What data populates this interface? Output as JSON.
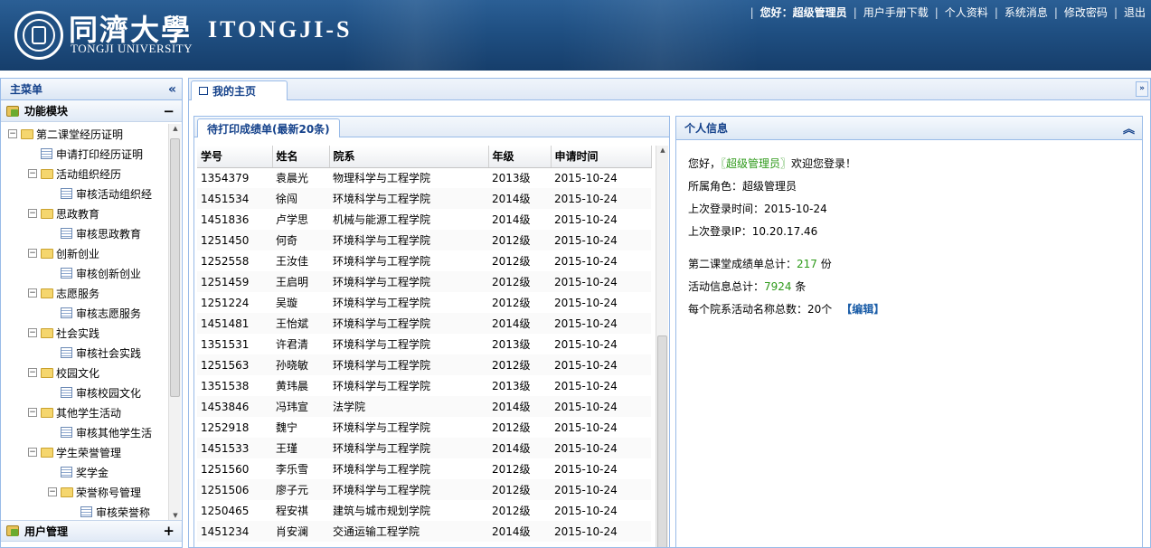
{
  "header": {
    "uni_cn": "同濟大學",
    "uni_en": "TONGJI UNIVERSITY",
    "app_title": "ITONGJI-S",
    "greeting": "您好：超级管理员",
    "links": [
      "用户手册下载",
      "个人资料",
      "系统消息",
      "修改密码",
      "退出"
    ]
  },
  "sidebar": {
    "title": "主菜单",
    "section_title": "功能模块",
    "tree": [
      {
        "label": "第二课堂经历证明",
        "level": 0,
        "type": "folder"
      },
      {
        "label": "申请打印经历证明",
        "level": 1,
        "type": "leaf"
      },
      {
        "label": "活动组织经历",
        "level": 1,
        "type": "folder"
      },
      {
        "label": "审核活动组织经",
        "level": 2,
        "type": "leaf"
      },
      {
        "label": "思政教育",
        "level": 1,
        "type": "folder"
      },
      {
        "label": "审核思政教育",
        "level": 2,
        "type": "leaf"
      },
      {
        "label": "创新创业",
        "level": 1,
        "type": "folder"
      },
      {
        "label": "审核创新创业",
        "level": 2,
        "type": "leaf"
      },
      {
        "label": "志愿服务",
        "level": 1,
        "type": "folder"
      },
      {
        "label": "审核志愿服务",
        "level": 2,
        "type": "leaf"
      },
      {
        "label": "社会实践",
        "level": 1,
        "type": "folder"
      },
      {
        "label": "审核社会实践",
        "level": 2,
        "type": "leaf"
      },
      {
        "label": "校园文化",
        "level": 1,
        "type": "folder"
      },
      {
        "label": "审核校园文化",
        "level": 2,
        "type": "leaf"
      },
      {
        "label": "其他学生活动",
        "level": 1,
        "type": "folder"
      },
      {
        "label": "审核其他学生活",
        "level": 2,
        "type": "leaf"
      },
      {
        "label": "学生荣誉管理",
        "level": 1,
        "type": "folder"
      },
      {
        "label": "奖学金",
        "level": 2,
        "type": "leaf"
      },
      {
        "label": "荣誉称号管理",
        "level": 2,
        "type": "folder"
      },
      {
        "label": "审核荣誉称",
        "level": 3,
        "type": "leaf"
      }
    ],
    "bottom_section": "用户管理"
  },
  "tabs": {
    "home": "我的主页"
  },
  "records": {
    "title": "待打印成绩单(最新20条)",
    "columns": [
      "学号",
      "姓名",
      "院系",
      "年级",
      "申请时间"
    ],
    "rows": [
      [
        "1354379",
        "袁晨光",
        "物理科学与工程学院",
        "2013级",
        "2015-10-24"
      ],
      [
        "1451534",
        "徐闯",
        "环境科学与工程学院",
        "2014级",
        "2015-10-24"
      ],
      [
        "1451836",
        "卢学思",
        "机械与能源工程学院",
        "2014级",
        "2015-10-24"
      ],
      [
        "1251450",
        "何奇",
        "环境科学与工程学院",
        "2012级",
        "2015-10-24"
      ],
      [
        "1252558",
        "王汝佳",
        "环境科学与工程学院",
        "2012级",
        "2015-10-24"
      ],
      [
        "1251459",
        "王启明",
        "环境科学与工程学院",
        "2012级",
        "2015-10-24"
      ],
      [
        "1251224",
        "吴璇",
        "环境科学与工程学院",
        "2012级",
        "2015-10-24"
      ],
      [
        "1451481",
        "王怡斌",
        "环境科学与工程学院",
        "2014级",
        "2015-10-24"
      ],
      [
        "1351531",
        "许君清",
        "环境科学与工程学院",
        "2013级",
        "2015-10-24"
      ],
      [
        "1251563",
        "孙晓敏",
        "环境科学与工程学院",
        "2012级",
        "2015-10-24"
      ],
      [
        "1351538",
        "黄玮晨",
        "环境科学与工程学院",
        "2013级",
        "2015-10-24"
      ],
      [
        "1453846",
        "冯玮宣",
        "法学院",
        "2014级",
        "2015-10-24"
      ],
      [
        "1252918",
        "魏宁",
        "环境科学与工程学院",
        "2012级",
        "2015-10-24"
      ],
      [
        "1451533",
        "王瑾",
        "环境科学与工程学院",
        "2014级",
        "2015-10-24"
      ],
      [
        "1251560",
        "李乐雪",
        "环境科学与工程学院",
        "2012级",
        "2015-10-24"
      ],
      [
        "1251506",
        "廖子元",
        "环境科学与工程学院",
        "2012级",
        "2015-10-24"
      ],
      [
        "1250465",
        "程安祺",
        "建筑与城市规划学院",
        "2012级",
        "2015-10-24"
      ],
      [
        "1451234",
        "肖安澜",
        "交通运输工程学院",
        "2014级",
        "2015-10-24"
      ]
    ]
  },
  "info": {
    "title": "个人信息",
    "greeting_prefix": "您好，",
    "role_tag": "〖超级管理员〗",
    "welcome": "欢迎您登录！",
    "role_label": "所属角色：",
    "role_value": "超级管理员",
    "last_login_label": "上次登录时间：",
    "last_login_value": "2015-10-24",
    "last_ip_label": "上次登录IP：",
    "last_ip_value": "10.20.17.46",
    "total_label": "第二课堂成绩单总计：",
    "total_value": "217",
    "total_unit": "份",
    "activity_label": "活动信息总计：",
    "activity_value": "7924",
    "activity_unit": "条",
    "dept_label": "每个院系活动名称总数：",
    "dept_value": "20个",
    "edit_label": "【编辑】"
  }
}
